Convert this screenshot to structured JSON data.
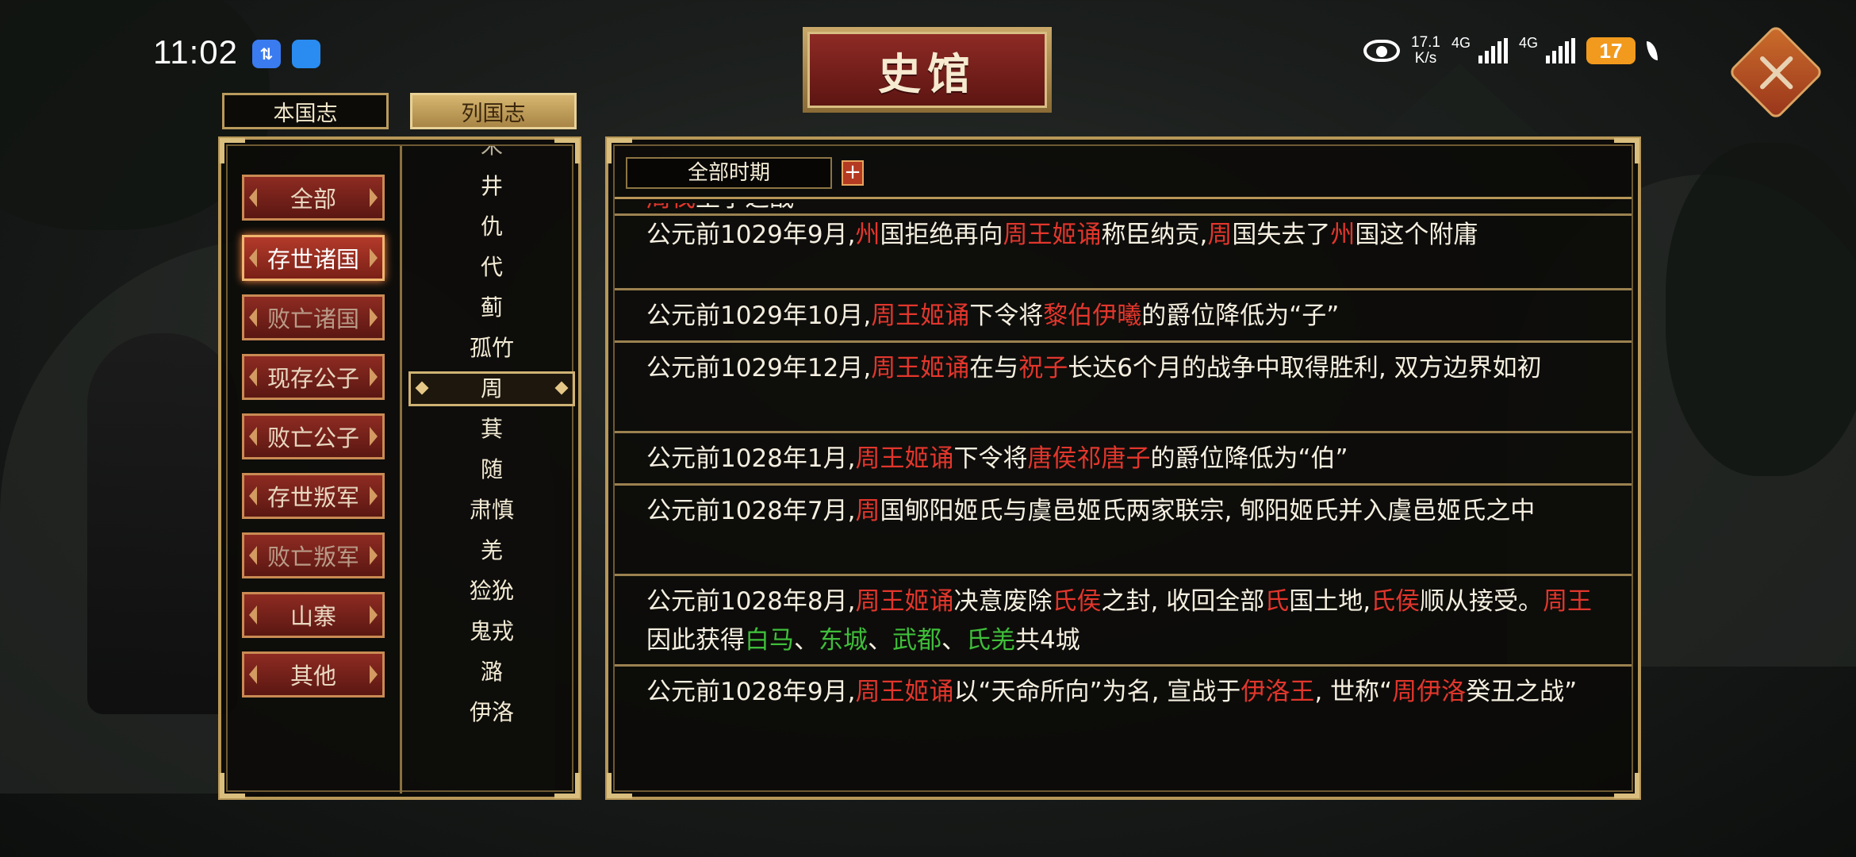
{
  "status_bar": {
    "time": "11:02",
    "net_speed_value": "17.1",
    "net_speed_unit": "K/s",
    "sim1_label": "4G",
    "sim2_label": "4G",
    "battery": "17",
    "app_icons": [
      "data-transfer-icon",
      "chat-icon"
    ]
  },
  "title": "史馆",
  "tabs": [
    {
      "label": "本国志",
      "active": false
    },
    {
      "label": "列国志",
      "active": true
    }
  ],
  "categories": [
    {
      "label": "全部",
      "state": "normal"
    },
    {
      "label": "存世诸国",
      "state": "active"
    },
    {
      "label": "败亡诸国",
      "state": "dim"
    },
    {
      "label": "现存公子",
      "state": "normal"
    },
    {
      "label": "败亡公子",
      "state": "normal"
    },
    {
      "label": "存世叛军",
      "state": "normal"
    },
    {
      "label": "败亡叛军",
      "state": "dim"
    },
    {
      "label": "山寨",
      "state": "normal"
    },
    {
      "label": "其他",
      "state": "normal"
    }
  ],
  "states": [
    "宋",
    "井",
    "仇",
    "代",
    "蓟",
    "孤竹",
    "周",
    "萁",
    "随",
    "肃慎",
    "羌",
    "猃狁",
    "鬼戎",
    "潞",
    "伊洛"
  ],
  "selected_state": "周",
  "period_filter": "全部时期",
  "plus_label": "+",
  "events": [
    {
      "segments": [
        [
          "周伐",
          "red"
        ],
        [
          "王子之战",
          "white"
        ]
      ],
      "cut": true
    },
    {
      "segments": [
        [
          "公元前1029年9月,",
          "white"
        ],
        [
          "州",
          "red"
        ],
        [
          "国拒绝再向",
          "white"
        ],
        [
          "周王姬诵",
          "red"
        ],
        [
          "称臣纳贡,",
          "white"
        ],
        [
          "周",
          "red"
        ],
        [
          "国失去了",
          "white"
        ],
        [
          "州",
          "red"
        ],
        [
          "国这个附庸",
          "white"
        ]
      ]
    },
    {
      "segments": [
        [
          "公元前1029年10月,",
          "white"
        ],
        [
          "周王姬诵",
          "red"
        ],
        [
          "下令将",
          "white"
        ],
        [
          "黎伯伊曦",
          "red"
        ],
        [
          "的爵位降低为“子”",
          "white"
        ]
      ]
    },
    {
      "segments": [
        [
          "公元前1029年12月,",
          "white"
        ],
        [
          "周王姬诵",
          "red"
        ],
        [
          "在与",
          "white"
        ],
        [
          "祝子",
          "red"
        ],
        [
          "长达6个月的战争中取得胜利, 双方边界如初",
          "white"
        ]
      ]
    },
    {
      "segments": [
        [
          "公元前1028年1月,",
          "white"
        ],
        [
          "周王姬诵",
          "red"
        ],
        [
          "下令将",
          "white"
        ],
        [
          "唐侯祁唐子",
          "red"
        ],
        [
          "的爵位降低为“伯”",
          "white"
        ]
      ]
    },
    {
      "segments": [
        [
          "公元前1028年7月,",
          "white"
        ],
        [
          "周",
          "red"
        ],
        [
          "国郇阳姬氏与虞邑姬氏两家联宗, 郇阳姬氏并入虞邑姬氏之中",
          "white"
        ]
      ]
    },
    {
      "segments": [
        [
          "公元前1028年8月,",
          "white"
        ],
        [
          "周王姬诵",
          "red"
        ],
        [
          "决意废除",
          "white"
        ],
        [
          "氏侯",
          "red"
        ],
        [
          "之封, 收回全部",
          "white"
        ],
        [
          "氏",
          "red"
        ],
        [
          "国土地,",
          "white"
        ],
        [
          "氏侯",
          "red"
        ],
        [
          "顺从接受。",
          "white"
        ],
        [
          "周王",
          "red"
        ],
        [
          "因此获得",
          "white"
        ],
        [
          "白马",
          "green"
        ],
        [
          "、",
          "white"
        ],
        [
          "东城",
          "green"
        ],
        [
          "、",
          "white"
        ],
        [
          "武都",
          "green"
        ],
        [
          "、",
          "white"
        ],
        [
          "氏羌",
          "green"
        ],
        [
          "共4城",
          "white"
        ]
      ]
    },
    {
      "segments": [
        [
          "公元前1028年9月,",
          "white"
        ],
        [
          "周王姬诵",
          "red"
        ],
        [
          "以“天命所向”为名, 宣战于",
          "white"
        ],
        [
          "伊洛王",
          "red"
        ],
        [
          ", 世称“",
          "white"
        ],
        [
          "周伊洛",
          "red"
        ],
        [
          "癸丑之战”",
          "white"
        ]
      ]
    }
  ]
}
